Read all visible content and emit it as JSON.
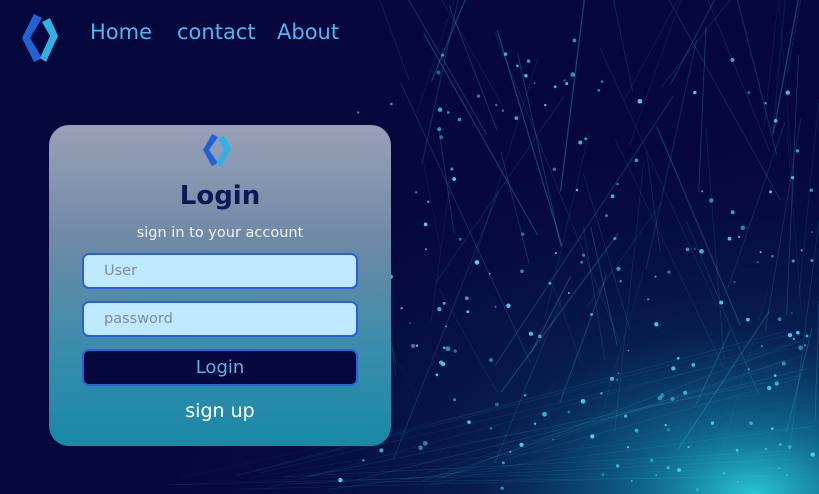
{
  "nav": {
    "items": [
      {
        "label": "Home"
      },
      {
        "label": "contact"
      },
      {
        "label": "About"
      }
    ]
  },
  "login": {
    "title": "Login",
    "subtitle": "sign in to your account",
    "user_placeholder": "User",
    "password_placeholder": "password",
    "button_label": "Login",
    "signup_label": "sign up"
  },
  "colors": {
    "background": "#06083d",
    "accent": "#4fb7ee",
    "particle": "#3fd8ee",
    "field_border": "#2a5fe0",
    "field_bg": "#bfe9ff"
  },
  "icons": {
    "logo": "chevron-diamond-logo-icon"
  }
}
